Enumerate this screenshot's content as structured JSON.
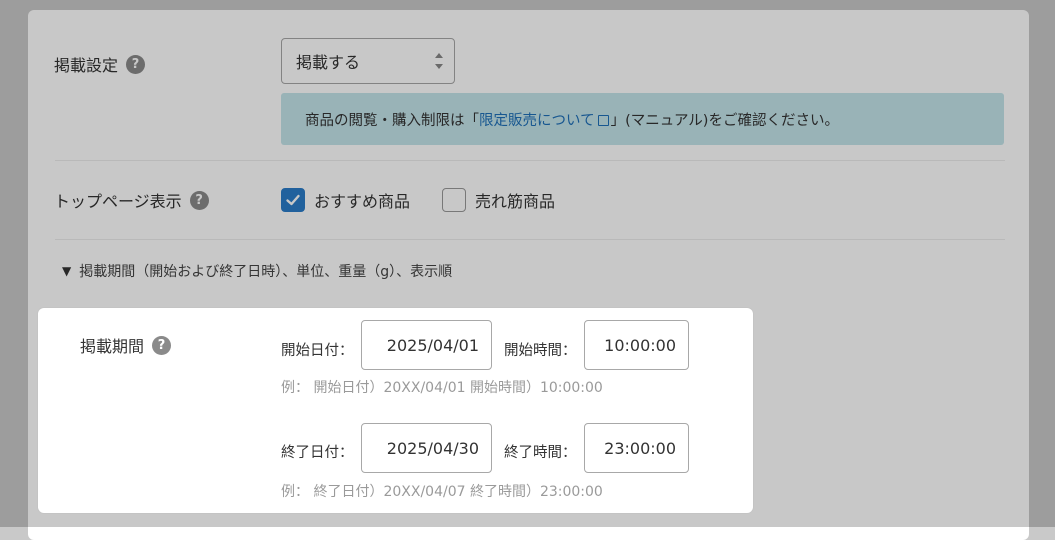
{
  "settings": {
    "listing": {
      "label": "掲載設定",
      "select_value": "掲載する",
      "notice_prefix": "商品の閲覧・購入制限は「",
      "notice_link": "限定販売について",
      "notice_suffix": "」(マニュアル)をご確認ください。"
    },
    "top_page": {
      "label": "トップページ表示",
      "checkboxes": [
        {
          "label": "おすすめ商品",
          "checked": true
        },
        {
          "label": "売れ筋商品",
          "checked": false
        }
      ]
    },
    "disclosure": {
      "icon": "▼",
      "label": "掲載期間（開始および終了日時）、単位、重量（g）、表示順"
    }
  },
  "period": {
    "label": "掲載期間",
    "help_icon": "?",
    "start_date_label": "開始日付：",
    "start_date": "2025/04/01",
    "start_time_label": "開始時間：",
    "start_time": "10:00:00",
    "start_example": "例： 開始日付）20XX/04/01 開始時間）10:00:00",
    "end_date_label": "終了日付：",
    "end_date": "2025/04/30",
    "end_time_label": "終了時間：",
    "end_time": "23:00:00",
    "end_example": "例： 終了日付）20XX/04/07 終了時間）23:00:00"
  },
  "colors": {
    "accent": "#2b7cc9",
    "notice_bg": "#c4e4ea",
    "link": "#1e6fb8",
    "help_icon": "#8a8a8a"
  }
}
